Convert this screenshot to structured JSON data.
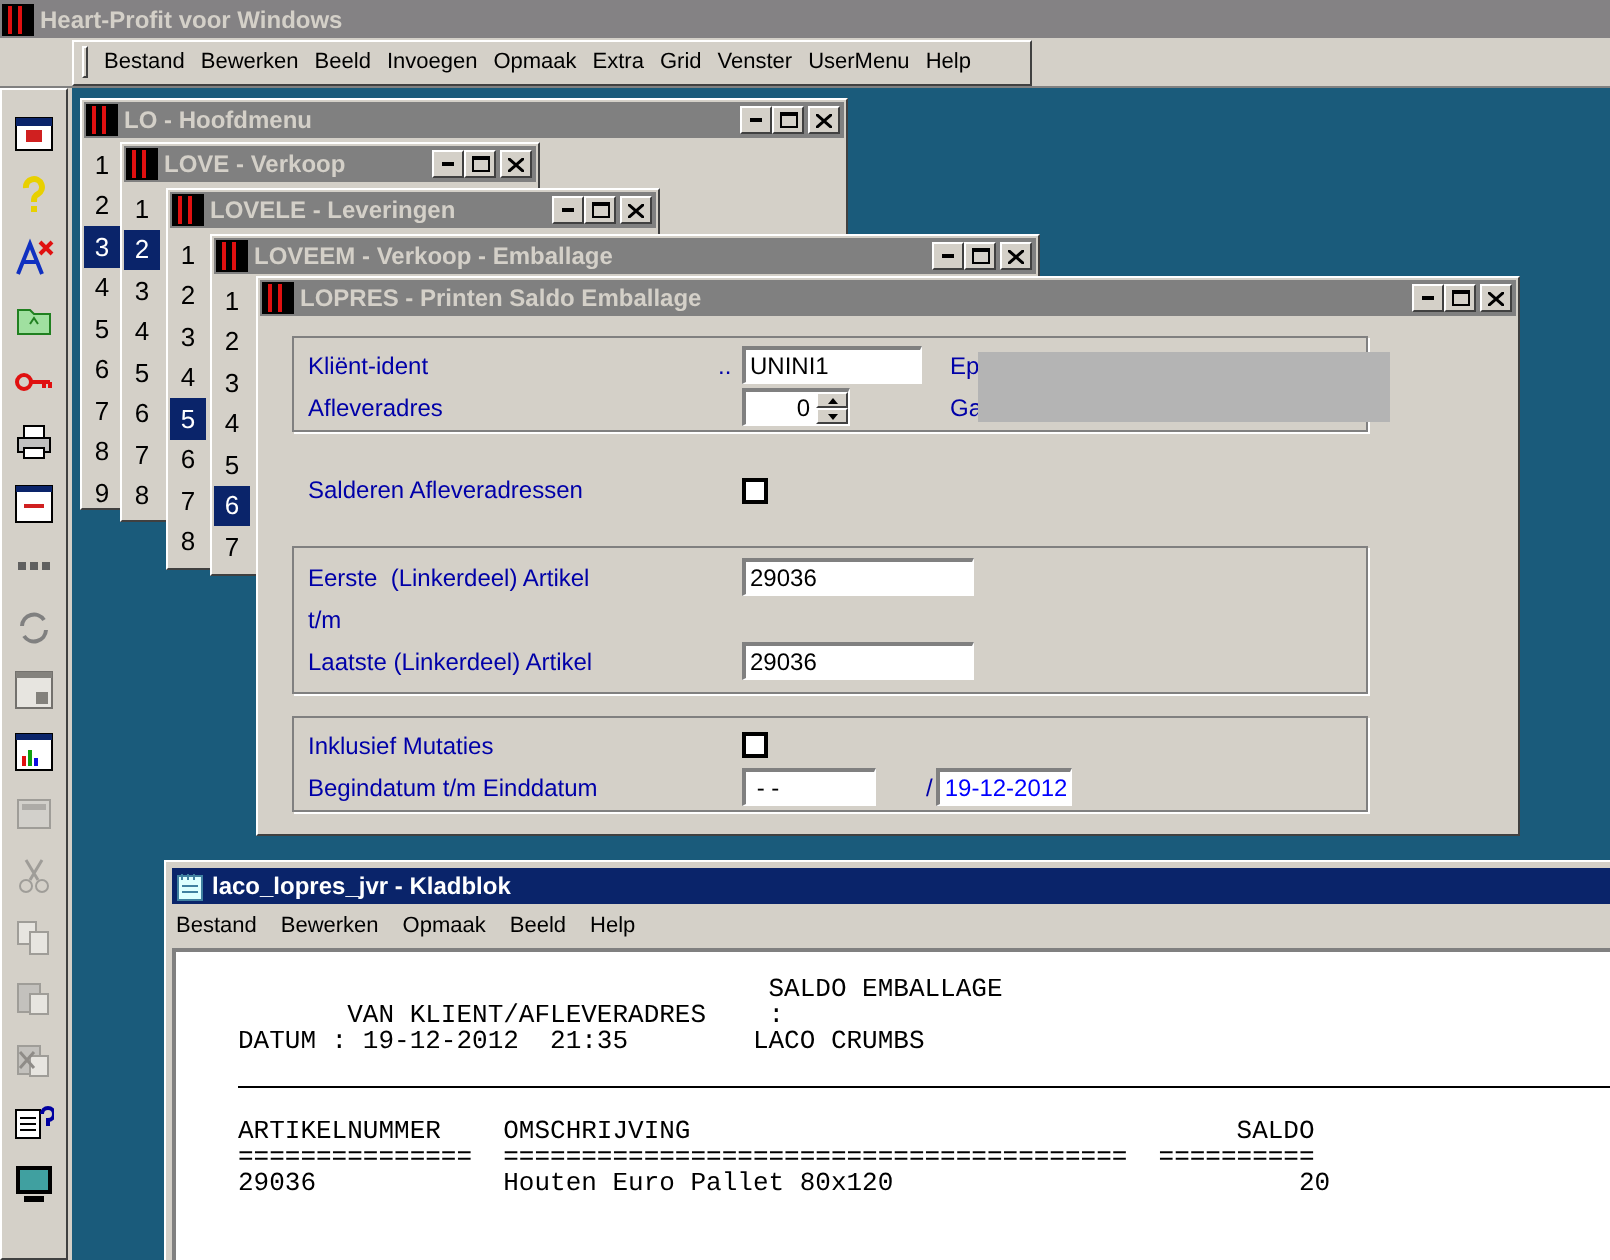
{
  "app": {
    "title": "Heart-Profit voor Windows"
  },
  "menu": [
    "Bestand",
    "Bewerken",
    "Beeld",
    "Invoegen",
    "Opmaak",
    "Extra",
    "Grid",
    "Venster",
    "UserMenu",
    "Help"
  ],
  "toolbar": [
    {
      "disabled": false
    },
    {
      "disabled": false
    },
    {
      "disabled": false
    },
    {
      "disabled": false
    },
    {
      "disabled": false
    },
    {
      "disabled": false
    },
    {
      "disabled": false
    },
    {
      "disabled": false
    },
    {
      "disabled": false
    },
    {
      "disabled": true
    },
    {
      "disabled": false
    },
    {
      "disabled": true
    },
    {
      "disabled": true
    },
    {
      "disabled": true
    },
    {
      "disabled": true
    },
    {
      "disabled": true
    },
    {
      "disabled": false
    },
    {
      "disabled": false
    }
  ],
  "windows": [
    {
      "title": "LO - Hoofdmenu",
      "items": [
        {
          "label": "1",
          "selected": false
        },
        {
          "label": "2",
          "selected": false
        },
        {
          "label": "3",
          "selected": true
        },
        {
          "label": "4",
          "selected": false
        },
        {
          "label": "5",
          "selected": false
        },
        {
          "label": "6",
          "selected": false
        },
        {
          "label": "7",
          "selected": false
        },
        {
          "label": "8",
          "selected": false
        },
        {
          "label": "9",
          "selected": false
        }
      ]
    },
    {
      "title": "LOVE - Verkoop",
      "items": [
        {
          "label": "1",
          "selected": false
        },
        {
          "label": "2",
          "selected": true
        },
        {
          "label": "3",
          "selected": false
        },
        {
          "label": "4",
          "selected": false
        },
        {
          "label": "5",
          "selected": false
        },
        {
          "label": "6",
          "selected": false
        },
        {
          "label": "7",
          "selected": false
        },
        {
          "label": "8",
          "selected": false
        }
      ]
    },
    {
      "title": "LOVELE - Leveringen",
      "items": [
        {
          "label": "1",
          "selected": false
        },
        {
          "label": "2",
          "selected": false
        },
        {
          "label": "3",
          "selected": false
        },
        {
          "label": "4",
          "selected": false
        },
        {
          "label": "5",
          "selected": true
        },
        {
          "label": "6",
          "selected": false
        },
        {
          "label": "7",
          "selected": false
        },
        {
          "label": "8",
          "selected": false
        }
      ]
    },
    {
      "title": "LOVEEM - Verkoop - Emballage",
      "items": [
        {
          "label": "1",
          "selected": false
        },
        {
          "label": "2",
          "selected": false
        },
        {
          "label": "3",
          "selected": false
        },
        {
          "label": "4",
          "selected": false
        },
        {
          "label": "5",
          "selected": false
        },
        {
          "label": "6",
          "selected": true
        },
        {
          "label": "7",
          "selected": false
        }
      ]
    }
  ],
  "form": {
    "title": "LOPRES - Printen Saldo Emballage",
    "client_label": "Kliënt-ident",
    "client_dots": "..",
    "client_value": "UNINI1",
    "client_side_label": "Ep",
    "address_label": "Afleveradres",
    "address_value": "0",
    "address_side_label": "Ga",
    "balance_label": "Salderen Afleveradressen",
    "balance_checked": false,
    "first_label": "Eerste  (Linkerdeel) Artikel",
    "first_value": "29036",
    "range_label": "t/m",
    "last_label": "Laatste (Linkerdeel) Artikel",
    "last_value": "29036",
    "mutations_label": "Inklusief Mutaties",
    "mutations_checked": false,
    "dates_label": "Begindatum t/m Einddatum",
    "start_date": " - -",
    "date_separator": "/",
    "end_date": "19-12-2012"
  },
  "notepad": {
    "title": "laco_lopres_jvr - Kladblok",
    "menu": [
      "Bestand",
      "Bewerken",
      "Opmaak",
      "Beeld",
      "Help"
    ],
    "header_lines": [
      "                                  SALDO EMBALLAGE",
      "       VAN KLIENT/AFLEVERADRES    :",
      "DATUM : 19-12-2012  21:35        LACO CRUMBS"
    ],
    "body_lines": [
      "ARTIKELNUMMER    OMSCHRIJVING                                   SALDO",
      "===============  ========================================  ==========",
      "29036            Houten Euro Pallet 80x120                          20"
    ]
  }
}
